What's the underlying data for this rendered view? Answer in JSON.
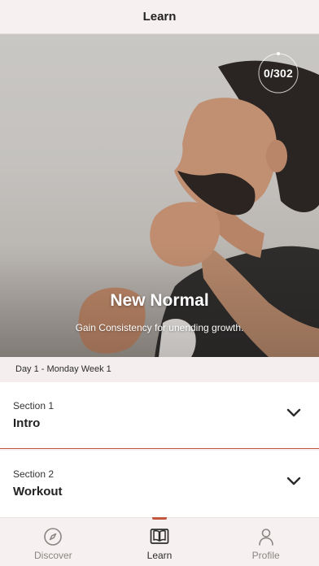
{
  "header": {
    "title": "Learn"
  },
  "hero": {
    "progress_text": "0/302",
    "progress_fraction": 0,
    "title": "New Normal",
    "subtitle": "Gain Consistency for unending growth."
  },
  "day_label": "Day 1 - Monday Week 1",
  "sections": [
    {
      "kicker": "Section 1",
      "name": "Intro",
      "expanded": false
    },
    {
      "kicker": "Section 2",
      "name": "Workout",
      "expanded": false
    }
  ],
  "tabs": [
    {
      "label": "Discover",
      "icon": "compass-icon",
      "active": false
    },
    {
      "label": "Learn",
      "icon": "book-icon",
      "active": true
    },
    {
      "label": "Profile",
      "icon": "person-icon",
      "active": false
    }
  ],
  "colors": {
    "accent": "#c0573e",
    "background": "#f4efee"
  }
}
